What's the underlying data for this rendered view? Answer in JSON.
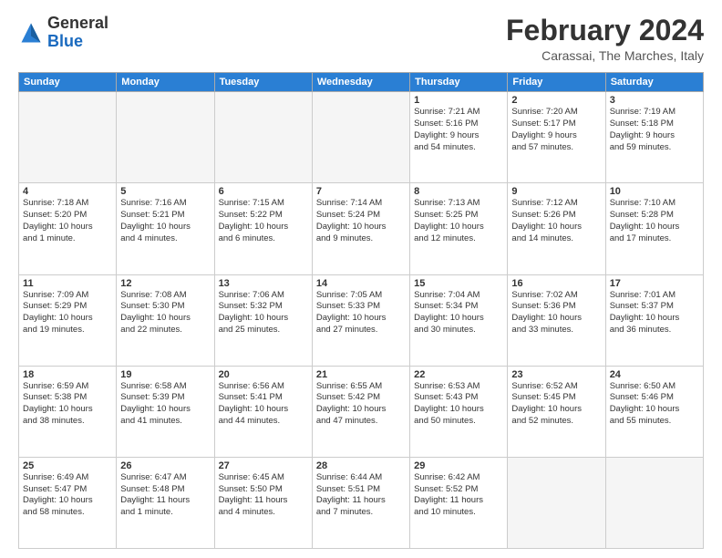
{
  "header": {
    "logo_general": "General",
    "logo_blue": "Blue",
    "month_title": "February 2024",
    "subtitle": "Carassai, The Marches, Italy"
  },
  "days_of_week": [
    "Sunday",
    "Monday",
    "Tuesday",
    "Wednesday",
    "Thursday",
    "Friday",
    "Saturday"
  ],
  "weeks": [
    [
      {
        "day": "",
        "info": ""
      },
      {
        "day": "",
        "info": ""
      },
      {
        "day": "",
        "info": ""
      },
      {
        "day": "",
        "info": ""
      },
      {
        "day": "1",
        "info": "Sunrise: 7:21 AM\nSunset: 5:16 PM\nDaylight: 9 hours\nand 54 minutes."
      },
      {
        "day": "2",
        "info": "Sunrise: 7:20 AM\nSunset: 5:17 PM\nDaylight: 9 hours\nand 57 minutes."
      },
      {
        "day": "3",
        "info": "Sunrise: 7:19 AM\nSunset: 5:18 PM\nDaylight: 9 hours\nand 59 minutes."
      }
    ],
    [
      {
        "day": "4",
        "info": "Sunrise: 7:18 AM\nSunset: 5:20 PM\nDaylight: 10 hours\nand 1 minute."
      },
      {
        "day": "5",
        "info": "Sunrise: 7:16 AM\nSunset: 5:21 PM\nDaylight: 10 hours\nand 4 minutes."
      },
      {
        "day": "6",
        "info": "Sunrise: 7:15 AM\nSunset: 5:22 PM\nDaylight: 10 hours\nand 6 minutes."
      },
      {
        "day": "7",
        "info": "Sunrise: 7:14 AM\nSunset: 5:24 PM\nDaylight: 10 hours\nand 9 minutes."
      },
      {
        "day": "8",
        "info": "Sunrise: 7:13 AM\nSunset: 5:25 PM\nDaylight: 10 hours\nand 12 minutes."
      },
      {
        "day": "9",
        "info": "Sunrise: 7:12 AM\nSunset: 5:26 PM\nDaylight: 10 hours\nand 14 minutes."
      },
      {
        "day": "10",
        "info": "Sunrise: 7:10 AM\nSunset: 5:28 PM\nDaylight: 10 hours\nand 17 minutes."
      }
    ],
    [
      {
        "day": "11",
        "info": "Sunrise: 7:09 AM\nSunset: 5:29 PM\nDaylight: 10 hours\nand 19 minutes."
      },
      {
        "day": "12",
        "info": "Sunrise: 7:08 AM\nSunset: 5:30 PM\nDaylight: 10 hours\nand 22 minutes."
      },
      {
        "day": "13",
        "info": "Sunrise: 7:06 AM\nSunset: 5:32 PM\nDaylight: 10 hours\nand 25 minutes."
      },
      {
        "day": "14",
        "info": "Sunrise: 7:05 AM\nSunset: 5:33 PM\nDaylight: 10 hours\nand 27 minutes."
      },
      {
        "day": "15",
        "info": "Sunrise: 7:04 AM\nSunset: 5:34 PM\nDaylight: 10 hours\nand 30 minutes."
      },
      {
        "day": "16",
        "info": "Sunrise: 7:02 AM\nSunset: 5:36 PM\nDaylight: 10 hours\nand 33 minutes."
      },
      {
        "day": "17",
        "info": "Sunrise: 7:01 AM\nSunset: 5:37 PM\nDaylight: 10 hours\nand 36 minutes."
      }
    ],
    [
      {
        "day": "18",
        "info": "Sunrise: 6:59 AM\nSunset: 5:38 PM\nDaylight: 10 hours\nand 38 minutes."
      },
      {
        "day": "19",
        "info": "Sunrise: 6:58 AM\nSunset: 5:39 PM\nDaylight: 10 hours\nand 41 minutes."
      },
      {
        "day": "20",
        "info": "Sunrise: 6:56 AM\nSunset: 5:41 PM\nDaylight: 10 hours\nand 44 minutes."
      },
      {
        "day": "21",
        "info": "Sunrise: 6:55 AM\nSunset: 5:42 PM\nDaylight: 10 hours\nand 47 minutes."
      },
      {
        "day": "22",
        "info": "Sunrise: 6:53 AM\nSunset: 5:43 PM\nDaylight: 10 hours\nand 50 minutes."
      },
      {
        "day": "23",
        "info": "Sunrise: 6:52 AM\nSunset: 5:45 PM\nDaylight: 10 hours\nand 52 minutes."
      },
      {
        "day": "24",
        "info": "Sunrise: 6:50 AM\nSunset: 5:46 PM\nDaylight: 10 hours\nand 55 minutes."
      }
    ],
    [
      {
        "day": "25",
        "info": "Sunrise: 6:49 AM\nSunset: 5:47 PM\nDaylight: 10 hours\nand 58 minutes."
      },
      {
        "day": "26",
        "info": "Sunrise: 6:47 AM\nSunset: 5:48 PM\nDaylight: 11 hours\nand 1 minute."
      },
      {
        "day": "27",
        "info": "Sunrise: 6:45 AM\nSunset: 5:50 PM\nDaylight: 11 hours\nand 4 minutes."
      },
      {
        "day": "28",
        "info": "Sunrise: 6:44 AM\nSunset: 5:51 PM\nDaylight: 11 hours\nand 7 minutes."
      },
      {
        "day": "29",
        "info": "Sunrise: 6:42 AM\nSunset: 5:52 PM\nDaylight: 11 hours\nand 10 minutes."
      },
      {
        "day": "",
        "info": ""
      },
      {
        "day": "",
        "info": ""
      }
    ]
  ]
}
